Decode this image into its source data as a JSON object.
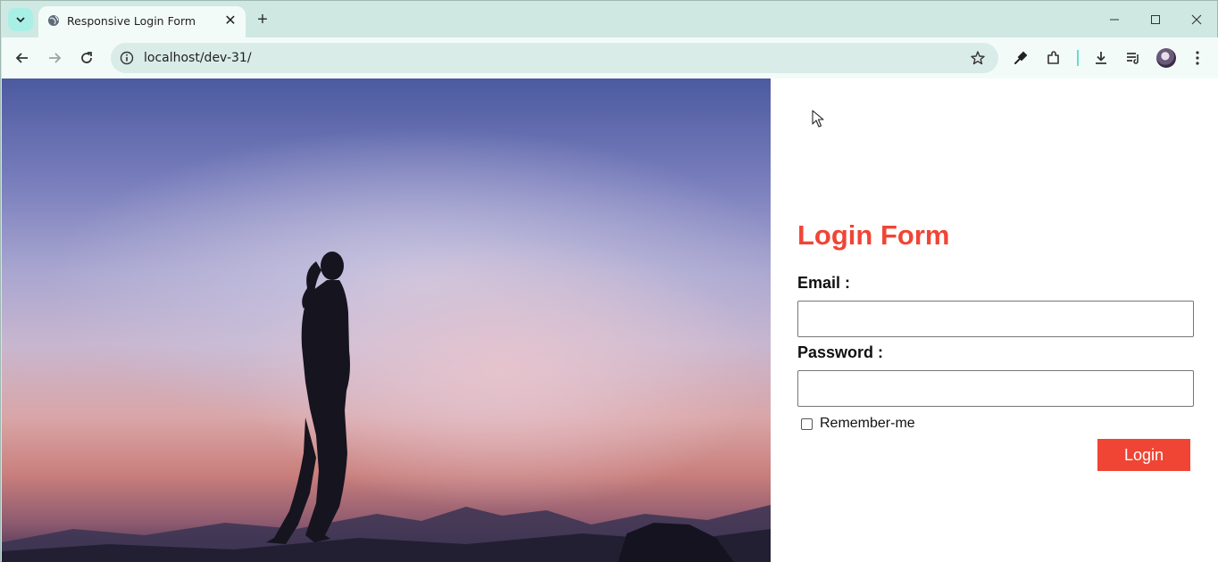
{
  "browser": {
    "tab_title": "Responsive Login Form",
    "url": "localhost/dev-31/",
    "icons": {
      "tab_menu": "chevron-down-icon",
      "favicon": "globe-icon",
      "tab_close": "close-icon",
      "new_tab": "plus-icon",
      "minimize": "minimize-icon",
      "maximize": "maximize-icon",
      "close_window": "close-window-icon",
      "back": "back-arrow-icon",
      "forward": "forward-arrow-icon",
      "reload": "reload-icon",
      "site_info": "info-icon",
      "bookmark": "star-icon",
      "eyedropper": "eyedropper-icon",
      "extensions": "puzzle-icon",
      "downloads": "download-icon",
      "media": "media-playlist-icon",
      "profile": "avatar",
      "menu": "more-vert-icon"
    }
  },
  "login": {
    "title": "Login Form",
    "email_label": "Email :",
    "email_value": "",
    "password_label": "Password :",
    "password_value": "",
    "remember_label": "Remember-me",
    "remember_checked": false,
    "button_label": "Login"
  },
  "colors": {
    "accent": "#f04535",
    "browser_chrome": "#cfe8e2",
    "toolbar": "#f3fbf9"
  }
}
